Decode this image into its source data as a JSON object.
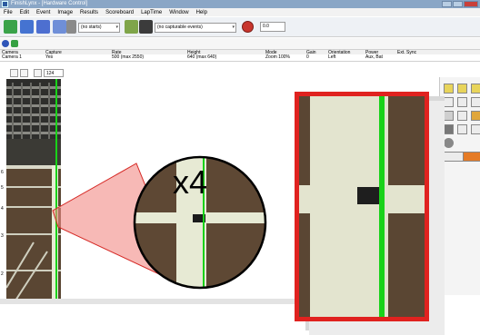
{
  "window": {
    "title": "FinishLynx - [Hardware Control]"
  },
  "menu": [
    "File",
    "Edit",
    "Event",
    "Image",
    "Results",
    "Scoreboard",
    "LapTime",
    "Window",
    "Help"
  ],
  "toolbar": {
    "starts_combo": "(no starts)",
    "events_combo": "(no capturable events)",
    "counter_value": "0.0"
  },
  "grid": {
    "headers": [
      "Camera",
      "Capture",
      "Rate",
      "Height",
      "Mode",
      "Gain",
      "Orientation",
      "Power",
      "Ext. Sync"
    ],
    "row": [
      "Camera 1",
      "Yes",
      "500  (max 2550)",
      "640  (max 640)",
      "Zoom 100%",
      "0",
      "Left",
      "Aux, Bat",
      ""
    ]
  },
  "view": {
    "zoom_field": "124",
    "ruler_labels": [
      "6",
      "5",
      "4",
      "3",
      "2"
    ]
  },
  "annotation": {
    "zoom_label": "x4"
  },
  "colors": {
    "finish_line": "#19d219",
    "callout_red": "#e0221f",
    "track_dark": "#5a4633",
    "track_light": "#e7ead4"
  }
}
